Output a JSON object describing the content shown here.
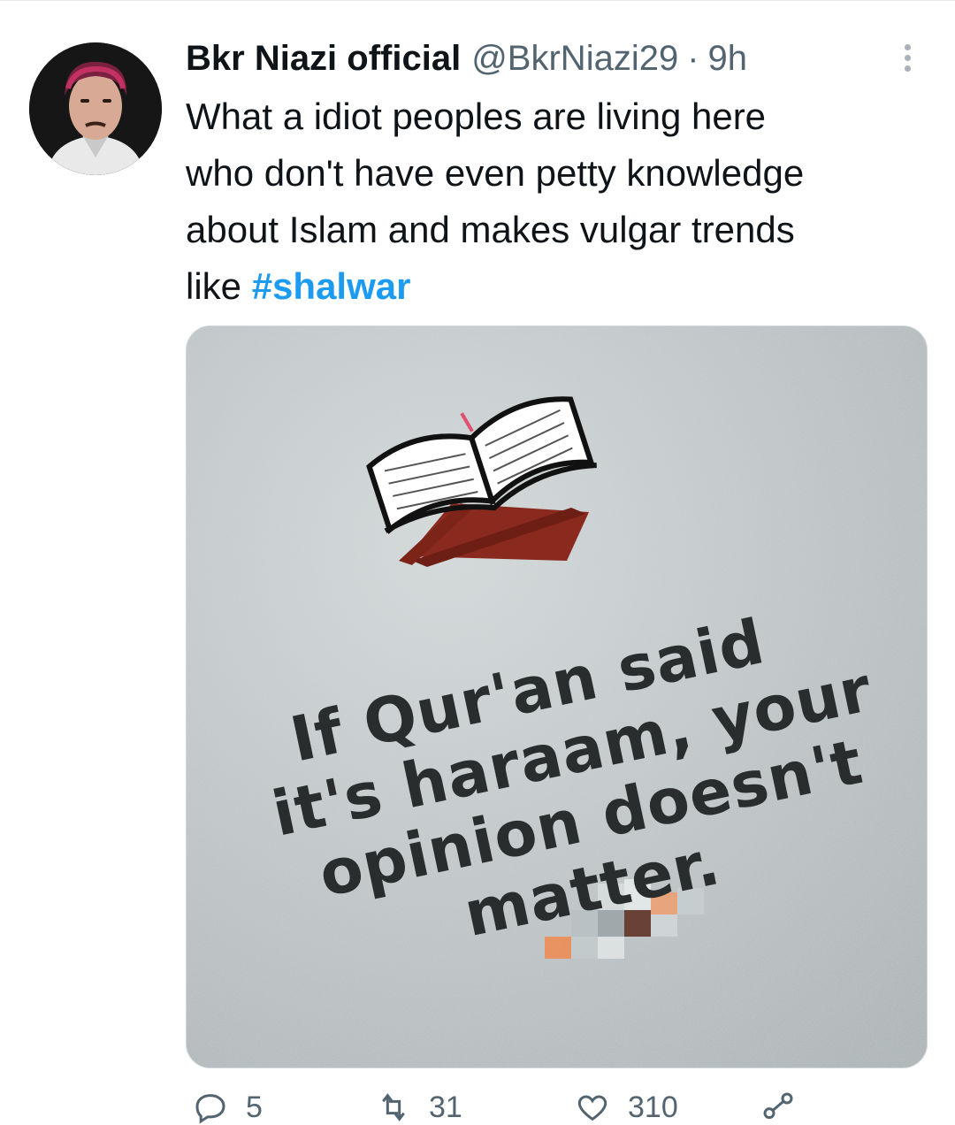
{
  "tweet": {
    "display_name": "Bkr Niazi official",
    "handle": "@BkrNiazi29",
    "separator": "·",
    "time": "9h",
    "text_lines": [
      "What a idiot peoples are living here",
      "who don't have even petty knowledge",
      "about Islam and makes vulgar trends"
    ],
    "text_last_prefix": "like ",
    "hashtag": "#shalwar",
    "image_text": [
      "If Qur'an said",
      "it's haraam, your",
      "opinion doesn't",
      "matter."
    ]
  },
  "actions": {
    "replies": "5",
    "retweets": "31",
    "likes": "310"
  },
  "colors": {
    "link": "#1d9bf0",
    "secondary": "#536471",
    "primary": "#0f1419"
  }
}
